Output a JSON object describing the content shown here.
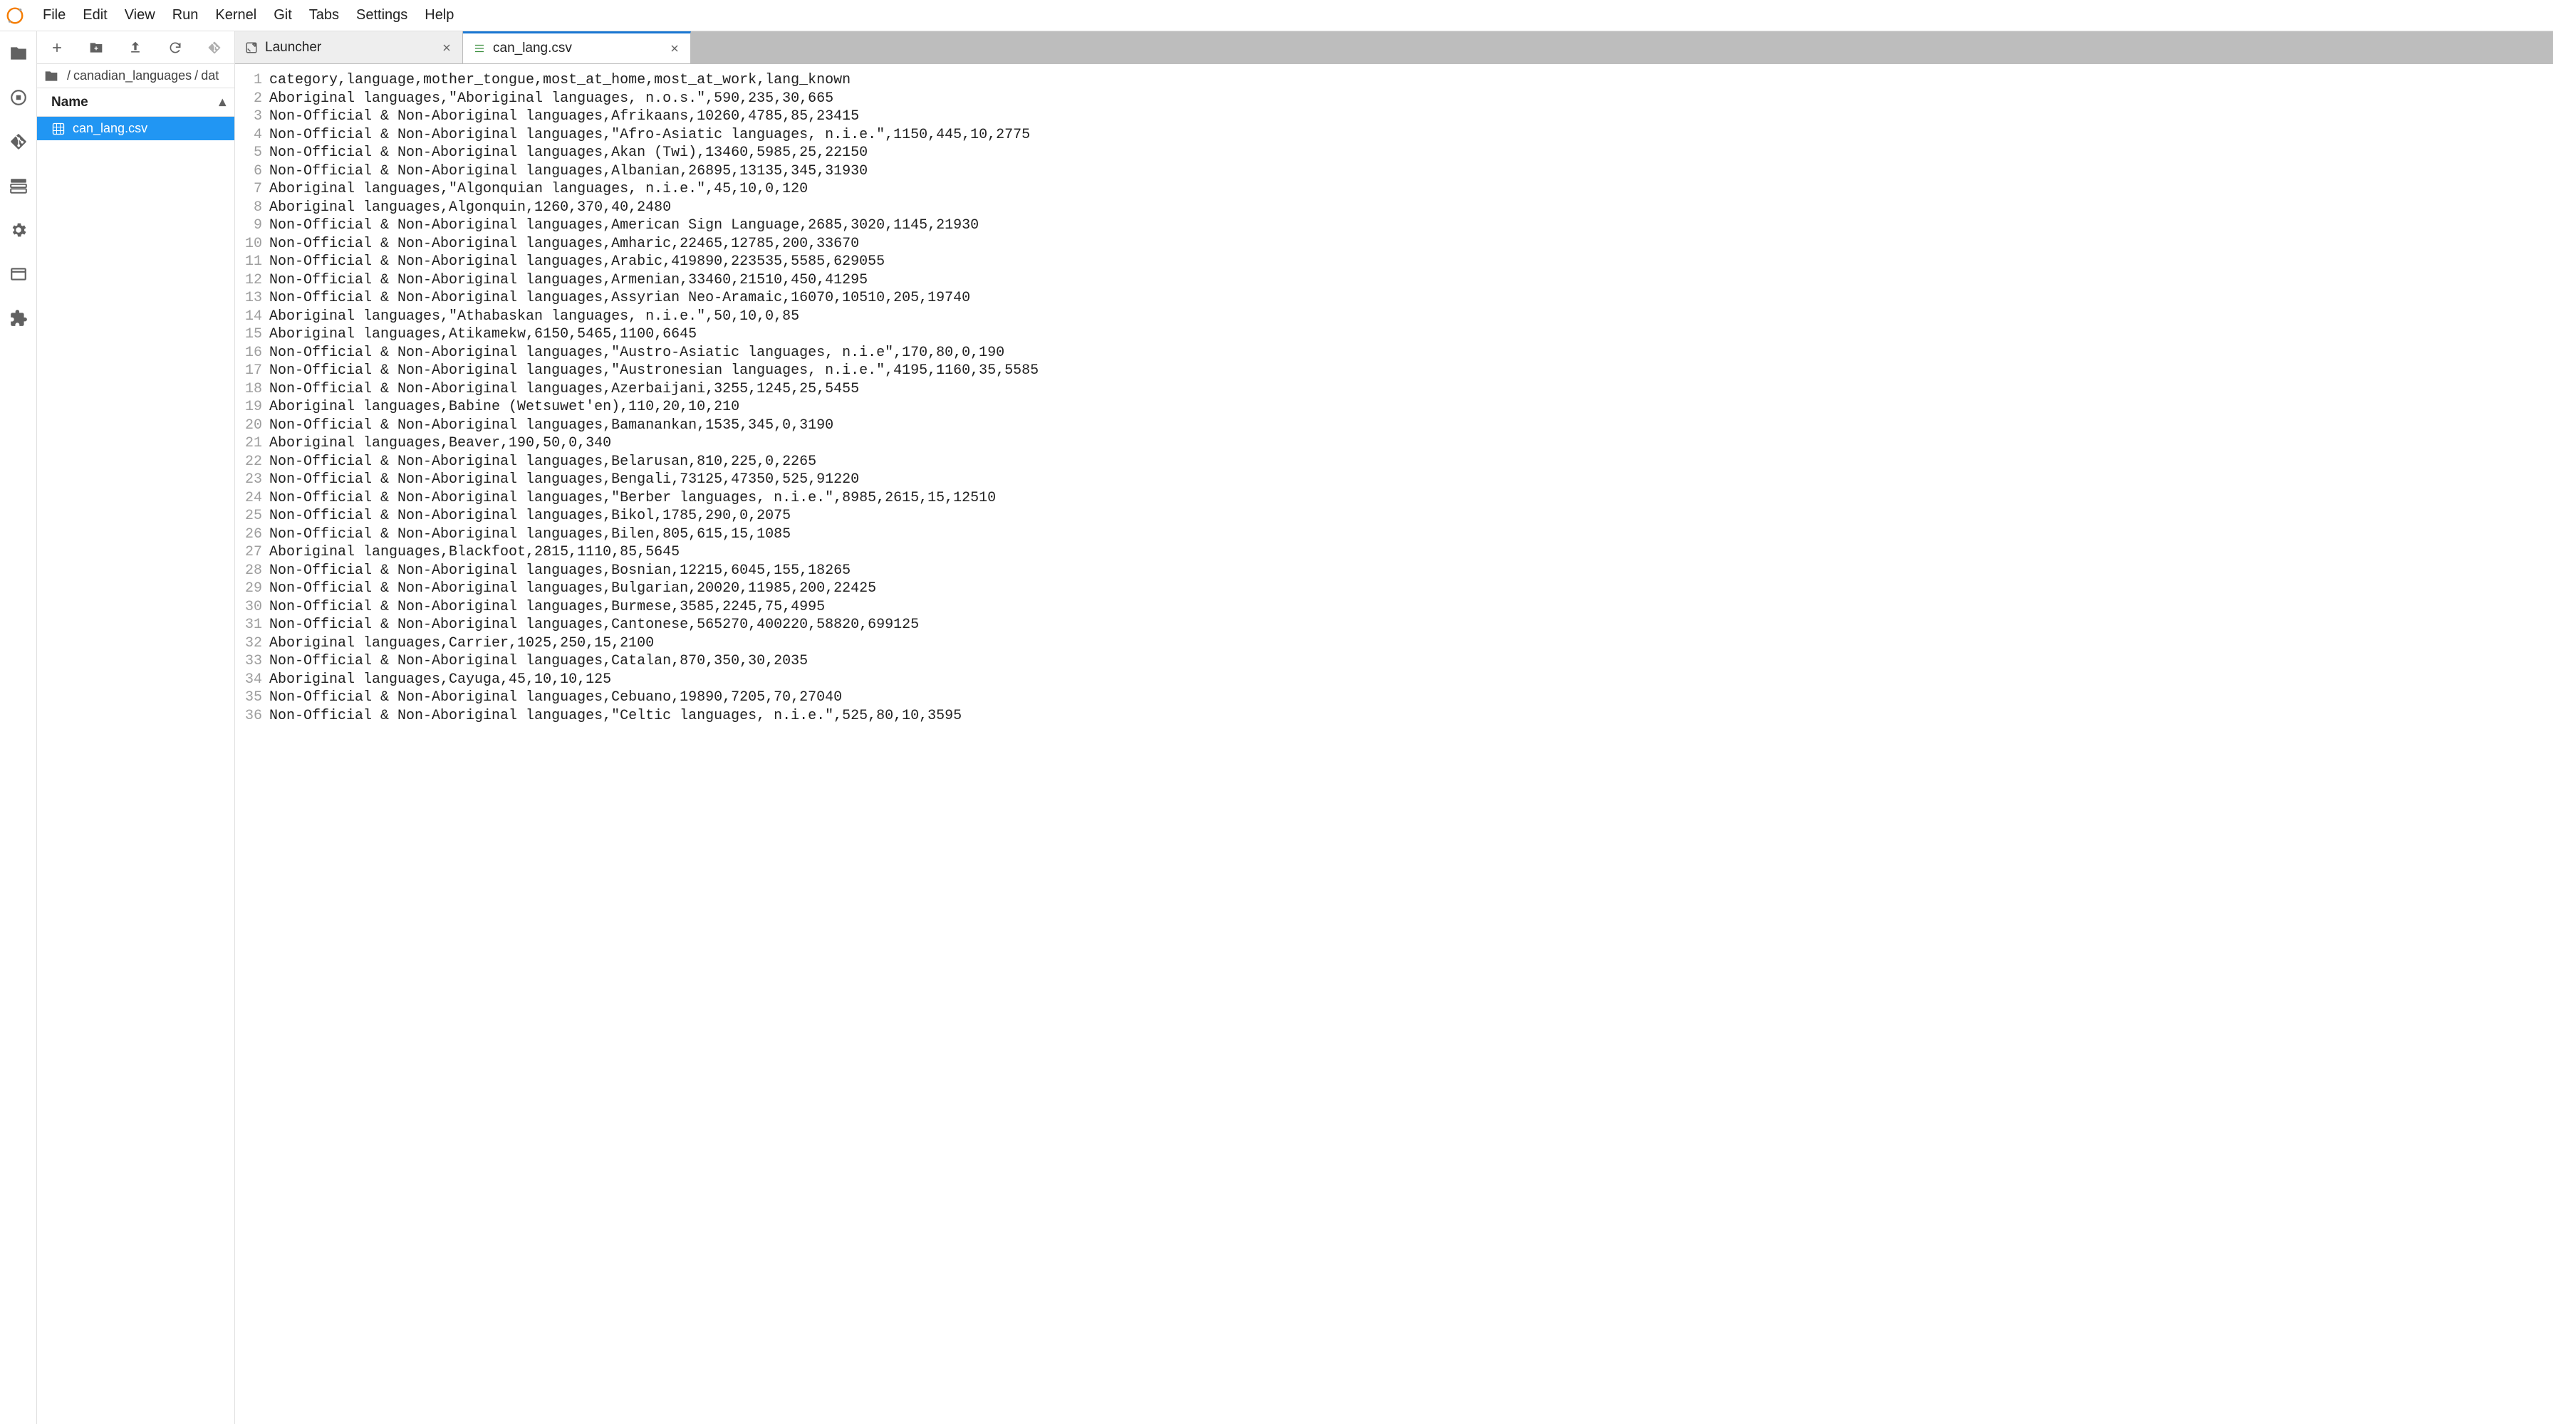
{
  "menubar": [
    "File",
    "Edit",
    "View",
    "Run",
    "Kernel",
    "Git",
    "Tabs",
    "Settings",
    "Help"
  ],
  "leftrail": [
    {
      "name": "folder-icon",
      "active": true
    },
    {
      "name": "running-icon"
    },
    {
      "name": "git-icon"
    },
    {
      "name": "commands-icon"
    },
    {
      "name": "settings-gear-icon"
    },
    {
      "name": "tabs-icon"
    },
    {
      "name": "extensions-icon"
    }
  ],
  "filepanel": {
    "toolbar": [
      {
        "name": "new-launcher-icon",
        "glyph": "plus"
      },
      {
        "name": "new-folder-icon",
        "glyph": "folder-plus"
      },
      {
        "name": "upload-icon",
        "glyph": "upload"
      },
      {
        "name": "refresh-icon",
        "glyph": "refresh"
      },
      {
        "name": "git-button-icon",
        "glyph": "git"
      }
    ],
    "breadcrumb": [
      "/",
      "canadian_languages",
      "/",
      "dat"
    ],
    "header": {
      "name": "Name",
      "sort_glyph": "▴"
    },
    "items": [
      {
        "name": "can_lang.csv",
        "icon": "spreadsheet-icon",
        "selected": true
      }
    ]
  },
  "tabs": [
    {
      "label": "Launcher",
      "icon": "launcher-icon",
      "active": false
    },
    {
      "label": "can_lang.csv",
      "icon": "spreadsheet-icon",
      "active": true
    }
  ],
  "editor_lines": [
    "category,language,mother_tongue,most_at_home,most_at_work,lang_known",
    "Aboriginal languages,\"Aboriginal languages, n.o.s.\",590,235,30,665",
    "Non-Official & Non-Aboriginal languages,Afrikaans,10260,4785,85,23415",
    "Non-Official & Non-Aboriginal languages,\"Afro-Asiatic languages, n.i.e.\",1150,445,10,2775",
    "Non-Official & Non-Aboriginal languages,Akan (Twi),13460,5985,25,22150",
    "Non-Official & Non-Aboriginal languages,Albanian,26895,13135,345,31930",
    "Aboriginal languages,\"Algonquian languages, n.i.e.\",45,10,0,120",
    "Aboriginal languages,Algonquin,1260,370,40,2480",
    "Non-Official & Non-Aboriginal languages,American Sign Language,2685,3020,1145,21930",
    "Non-Official & Non-Aboriginal languages,Amharic,22465,12785,200,33670",
    "Non-Official & Non-Aboriginal languages,Arabic,419890,223535,5585,629055",
    "Non-Official & Non-Aboriginal languages,Armenian,33460,21510,450,41295",
    "Non-Official & Non-Aboriginal languages,Assyrian Neo-Aramaic,16070,10510,205,19740",
    "Aboriginal languages,\"Athabaskan languages, n.i.e.\",50,10,0,85",
    "Aboriginal languages,Atikamekw,6150,5465,1100,6645",
    "Non-Official & Non-Aboriginal languages,\"Austro-Asiatic languages, n.i.e\",170,80,0,190",
    "Non-Official & Non-Aboriginal languages,\"Austronesian languages, n.i.e.\",4195,1160,35,5585",
    "Non-Official & Non-Aboriginal languages,Azerbaijani,3255,1245,25,5455",
    "Aboriginal languages,Babine (Wetsuwet'en),110,20,10,210",
    "Non-Official & Non-Aboriginal languages,Bamanankan,1535,345,0,3190",
    "Aboriginal languages,Beaver,190,50,0,340",
    "Non-Official & Non-Aboriginal languages,Belarusan,810,225,0,2265",
    "Non-Official & Non-Aboriginal languages,Bengali,73125,47350,525,91220",
    "Non-Official & Non-Aboriginal languages,\"Berber languages, n.i.e.\",8985,2615,15,12510",
    "Non-Official & Non-Aboriginal languages,Bikol,1785,290,0,2075",
    "Non-Official & Non-Aboriginal languages,Bilen,805,615,15,1085",
    "Aboriginal languages,Blackfoot,2815,1110,85,5645",
    "Non-Official & Non-Aboriginal languages,Bosnian,12215,6045,155,18265",
    "Non-Official & Non-Aboriginal languages,Bulgarian,20020,11985,200,22425",
    "Non-Official & Non-Aboriginal languages,Burmese,3585,2245,75,4995",
    "Non-Official & Non-Aboriginal languages,Cantonese,565270,400220,58820,699125",
    "Aboriginal languages,Carrier,1025,250,15,2100",
    "Non-Official & Non-Aboriginal languages,Catalan,870,350,30,2035",
    "Aboriginal languages,Cayuga,45,10,10,125",
    "Non-Official & Non-Aboriginal languages,Cebuano,19890,7205,70,27040",
    "Non-Official & Non-Aboriginal languages,\"Celtic languages, n.i.e.\",525,80,10,3595"
  ]
}
